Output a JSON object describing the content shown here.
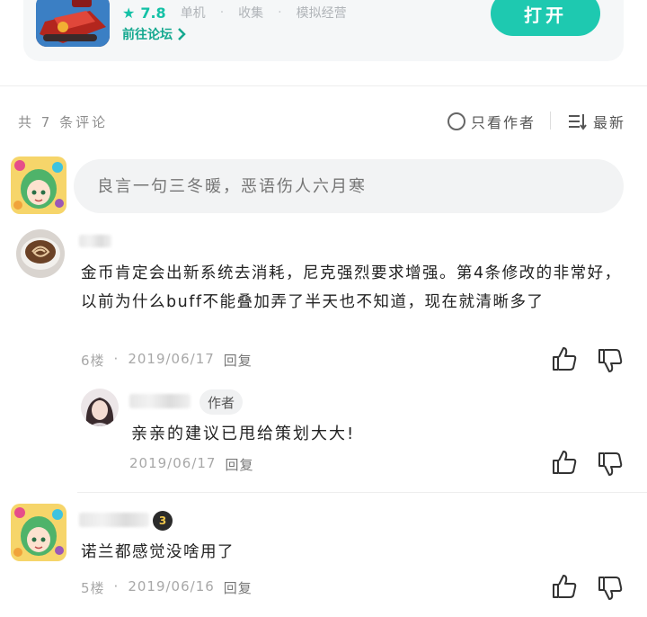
{
  "game": {
    "rating": "7.8",
    "tags": [
      "单机",
      "收集",
      "模拟经营"
    ],
    "forum_link": "前往论坛",
    "open_button": "打开",
    "accent_color": "#1ec9b0"
  },
  "comments_header": {
    "count_label": "共 7 条评论",
    "only_author": "只看作者",
    "sort": "最新"
  },
  "comment_input": {
    "placeholder": "良言一句三冬暖，恶语伤人六月寒"
  },
  "comments": [
    {
      "text": "金币肯定会出新系统去消耗，尼克强烈要求增强。第4条修改的非常好，以前为什么buff不能叠加弄了半天也不知道，现在就清晰多了",
      "floor": "6楼",
      "date": "2019/06/17",
      "reply_label": "回复",
      "replies": [
        {
          "badge": "作者",
          "text": "亲亲的建议已甩给策划大大!",
          "date": "2019/06/17",
          "reply_label": "回复"
        }
      ]
    },
    {
      "text": "诺兰都感觉没啥用了",
      "floor": "5楼",
      "date": "2019/06/16",
      "reply_label": "回复",
      "level_badge": "3"
    }
  ],
  "icons": {
    "like": "thumbs-up-icon",
    "dislike": "thumbs-down-icon",
    "star": "star-icon",
    "chevron": "chevron-right-icon",
    "sort": "sort-lines-icon"
  }
}
